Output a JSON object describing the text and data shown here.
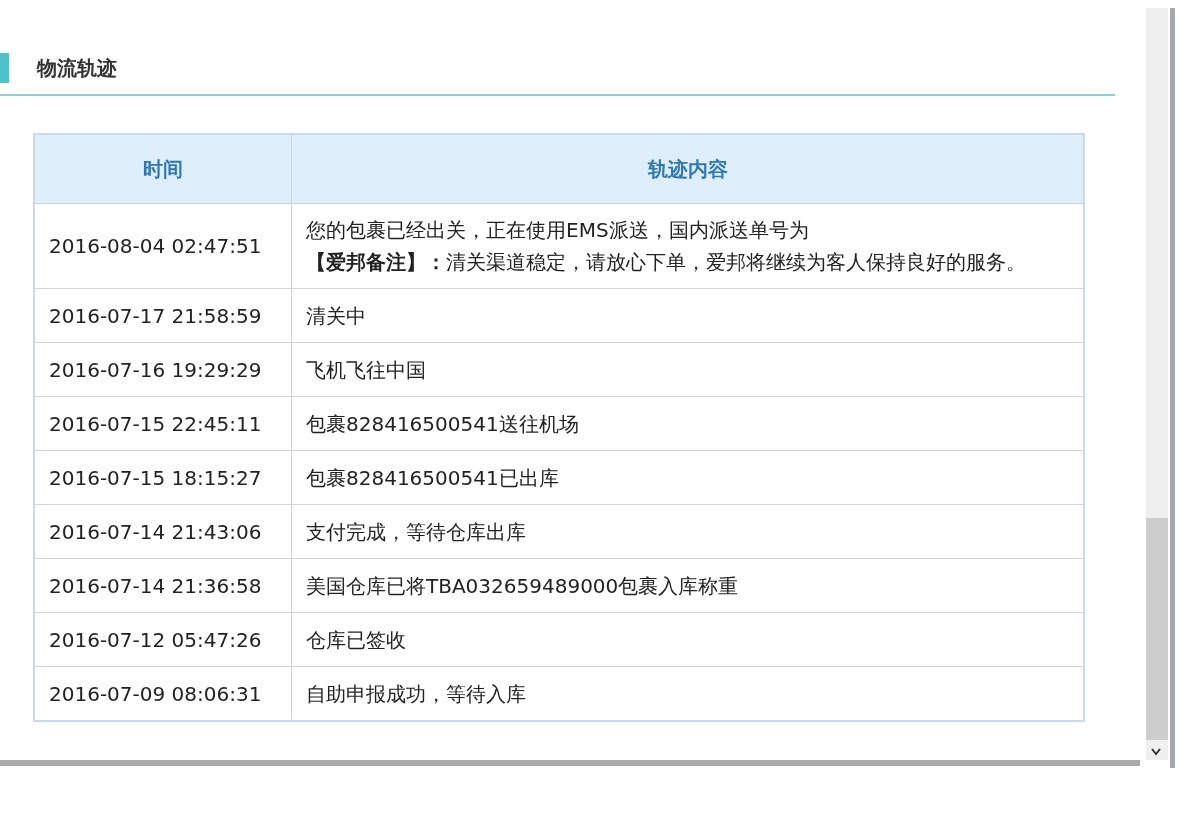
{
  "section": {
    "title": "物流轨迹"
  },
  "table": {
    "columns": [
      "时间",
      "轨迹内容"
    ],
    "rows": [
      {
        "time": "2016-08-04 02:47:51",
        "content": [
          "您的包裹已经出关，正在使用EMS派送，国内派送单号为",
          "**【爱邦备注】：**清关渠道稳定，请放心下单，爱邦将继续为客人保持良好的服务。"
        ]
      },
      {
        "time": "2016-07-17 21:58:59",
        "content": [
          "清关中"
        ]
      },
      {
        "time": "2016-07-16 19:29:29",
        "content": [
          "飞机飞往中国"
        ]
      },
      {
        "time": "2016-07-15 22:45:11",
        "content": [
          "包裹828416500541送往机场"
        ]
      },
      {
        "time": "2016-07-15 18:15:27",
        "content": [
          "包裹828416500541已出库"
        ]
      },
      {
        "time": "2016-07-14 21:43:06",
        "content": [
          "支付完成，等待仓库出库"
        ]
      },
      {
        "time": "2016-07-14 21:36:58",
        "content": [
          "美国仓库已将TBA032659489000包裹入库称重"
        ]
      },
      {
        "time": "2016-07-12 05:47:26",
        "content": [
          "仓库已签收"
        ]
      },
      {
        "time": "2016-07-09 08:06:31",
        "content": [
          "自助申报成功，等待入库"
        ]
      }
    ]
  }
}
